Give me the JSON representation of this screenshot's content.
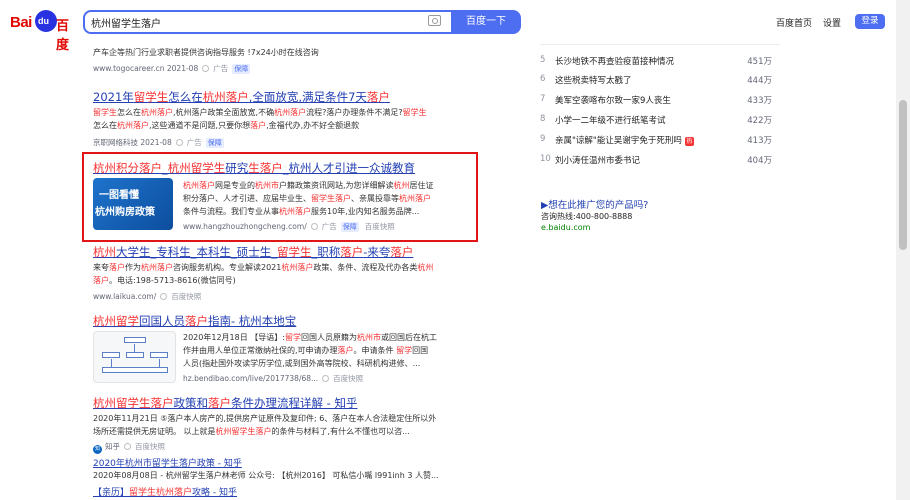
{
  "header": {
    "logo_bai": "Bai",
    "logo_paw": "du",
    "logo_du": "百度",
    "search_query": "杭州留学生落户",
    "search_button": "百度一下",
    "link_home": "百度首页",
    "link_settings": "设置",
    "login_button": "登录"
  },
  "results": {
    "r0": {
      "snippet": "产车企等热门行业求职者提供咨询指导服务 !7x24小时在线咨询",
      "meta_url": "www.togocareer.cn 2021-08",
      "ad_label": "广告",
      "protect_label": "保障"
    },
    "r1": {
      "title_parts": [
        "2021年",
        "留学生",
        "怎么在",
        "杭州落户",
        ",全面放宽,满足条件7天",
        "落户"
      ],
      "line1": [
        "留学生",
        "怎么在",
        "杭州落户",
        ",杭州落户政策全面放宽,不确",
        "杭州落户",
        "流程?落户办理条件不满足?",
        "留学生"
      ],
      "line2": [
        "怎么在",
        "杭州落户",
        ",这些通道不是问题,只要你想",
        "落户",
        ",金福代办,办不好全额退款"
      ],
      "meta_url": "京职网络科技 2021-08",
      "ad_label": "广告",
      "protect_label": "保障"
    },
    "r2": {
      "title_parts": [
        "杭州积分落户",
        "_",
        "杭州留学生",
        "研究",
        "生落户",
        "_杭州人才引进一众诚教育"
      ],
      "line1": [
        "杭州落户",
        "网是专业的",
        "杭州市",
        "户籍政策资讯网站,为您详细解读",
        "杭州",
        "居住证"
      ],
      "line2": [
        "积分落户、人才引进、应届毕业生、",
        "留学生落户",
        "、亲属投靠等",
        "杭州落户"
      ],
      "line3": [
        "条件与流程。我们专业从事",
        "杭州落户",
        "服务10年,业内知名服务品牌..."
      ],
      "meta_url": "www.hangzhouzhongcheng.com/",
      "ad_label": "广告",
      "protect_label": "保障",
      "kuaizhao": "百度快照",
      "image_line1": "一图看懂",
      "image_line2": "杭州购房政策"
    },
    "r3": {
      "title_parts": [
        "杭州",
        "大学生_专科生_本科生_硕士生_",
        "留学生",
        "_职称",
        "落户",
        "-来夸",
        "落户"
      ],
      "line1": [
        "来夸",
        "落户",
        "作为",
        "杭州落户",
        "咨询服务机构。专业解读2021",
        "杭州落户",
        "政策、条件、流程及代办各类",
        "杭州"
      ],
      "line2": [
        "落户",
        "。电话:198-5713-8616(微信同号)"
      ],
      "meta_url": "www.laikua.com/",
      "kuaizhao": "百度快照"
    },
    "r4": {
      "title_parts": [
        "杭州留学",
        "回国人员",
        "落户",
        "指南- 杭州本地宝"
      ],
      "line1": [
        "2020年12月18日 【导语】:",
        "留学",
        "回国人员原籍为",
        "杭州市",
        "或回国后在杭工"
      ],
      "line2": [
        "作并由用人单位正常缴纳社保的,可申请办理",
        "落户",
        "。申请条件 ",
        "留学",
        "回国"
      ],
      "line3": [
        "人员(指赴国外攻读学历学位,或到国外高等院校、科研机构进修、..."
      ],
      "meta_url": "hz.bendibao.com/live/2017738/68...",
      "kuaizhao": "百度快照"
    },
    "r5": {
      "title_parts": [
        "杭州留学生落户",
        "政策和",
        "落户",
        "条件办理流程详解 - 知乎"
      ],
      "line1": [
        "2020年11月21日 ",
        "⑤",
        "落户本人房产的,提供房产证原件及复印件; 6、落户在本人合法稳定住所以外"
      ],
      "line2": [
        "场所还需提供无房证明。 以上就是",
        "杭州留学生落户",
        "的条件与材料了,有什么不懂也可以咨..."
      ],
      "meta_source": "知乎",
      "kuaizhao": "百度快照"
    },
    "r6": {
      "title": "2020年杭州市留学生落户政策 - 知乎",
      "snippet": "2020年08月08日 - 杭州留学生落户林老师 公众号: 【杭州2016】 可私信小嘴 l991inh 3 人赞..."
    },
    "r7": {
      "tag": "【亲历】",
      "title_parts": [
        "留学生",
        "杭州落户",
        "攻略 - 知乎"
      ]
    }
  },
  "hot_list": [
    {
      "num": "5",
      "text": "长沙地铁不再查验疫苗接种情况",
      "count": "451万",
      "tag": ""
    },
    {
      "num": "6",
      "text": "这些税卖特写太戳了",
      "count": "444万",
      "tag": ""
    },
    {
      "num": "7",
      "text": "美军空袭喀布尔致一家9人丧生",
      "count": "433万",
      "tag": ""
    },
    {
      "num": "8",
      "text": "小学一二年级不进行纸笔考试",
      "count": "422万",
      "tag": ""
    },
    {
      "num": "9",
      "text": "亲属\"谅解\"能让吴谢宇免于死刑吗",
      "count": "413万",
      "tag": "热"
    },
    {
      "num": "10",
      "text": "刘小涛任温州市委书记",
      "count": "404万",
      "tag": ""
    }
  ],
  "promo": {
    "title": "▶想在此推广您的产品吗?",
    "phone": "咨询热线:400-800-8888",
    "url": "e.baidu.com"
  }
}
